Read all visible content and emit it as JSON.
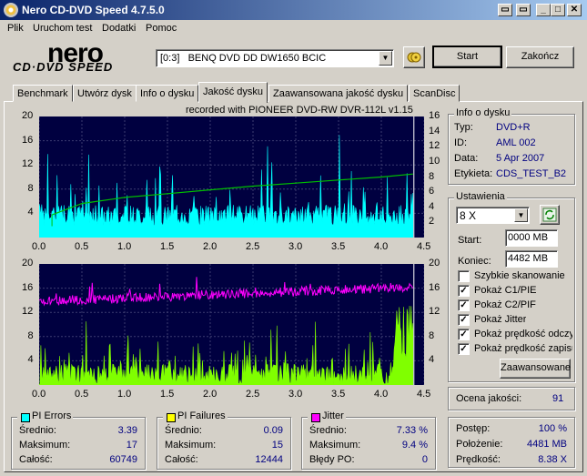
{
  "window": {
    "title": "Nero CD-DVD Speed 4.7.5.0"
  },
  "menu": [
    "Plik",
    "Uruchom test",
    "Dodatki",
    "Pomoc"
  ],
  "logo": {
    "brand": "nero",
    "product": "CD·DVD SPEED"
  },
  "drive": {
    "selected": "[0:3]   BENQ DVD DD DW1650 BCIC"
  },
  "buttons": {
    "start": "Start",
    "exit": "Zakończ",
    "advanced": "Zaawansowane"
  },
  "tabs": [
    "Benchmark",
    "Utwórz dysk",
    "Info o dysku",
    "Jakość dysku",
    "Zaawansowana jakość dysku",
    "ScanDisc"
  ],
  "active_tab": "Jakość dysku",
  "chart_header": "recorded with PIONEER DVD-RW  DVR-112L v1.15",
  "disc_info": {
    "title": "Info o dysku",
    "rows": [
      {
        "label": "Typ:",
        "value": "DVD+R"
      },
      {
        "label": "ID:",
        "value": "AML 002"
      },
      {
        "label": "Data:",
        "value": "5 Apr 2007"
      },
      {
        "label": "Etykieta:",
        "value": "CDS_TEST_B2"
      }
    ]
  },
  "settings": {
    "title": "Ustawienia",
    "speed": "8 X",
    "start_label": "Start:",
    "start_value": "0000 MB",
    "end_label": "Koniec:",
    "end_value": "4482 MB",
    "checkboxes": [
      {
        "label": "Szybkie skanowanie",
        "checked": false
      },
      {
        "label": "Pokaż C1/PIE",
        "checked": true
      },
      {
        "label": "Pokaż C2/PIF",
        "checked": true
      },
      {
        "label": "Pokaż Jitter",
        "checked": true
      },
      {
        "label": "Pokaż prędkość odczytu",
        "checked": true
      },
      {
        "label": "Pokaż prędkość zapisu",
        "checked": true
      }
    ]
  },
  "quality": {
    "label": "Ocena jakości:",
    "value": "91"
  },
  "progress": {
    "rows": [
      {
        "label": "Postęp:",
        "value": "100 %"
      },
      {
        "label": "Położenie:",
        "value": "4481 MB"
      },
      {
        "label": "Prędkość:",
        "value": "8.38 X"
      }
    ]
  },
  "stats": {
    "pi_errors": {
      "title": "PI Errors",
      "color": "#00ffff",
      "rows": [
        {
          "label": "Średnio:",
          "value": "3.39"
        },
        {
          "label": "Maksimum:",
          "value": "17"
        },
        {
          "label": "Całość:",
          "value": "60749"
        }
      ]
    },
    "pi_failures": {
      "title": "PI Failures",
      "color": "#ffff00",
      "rows": [
        {
          "label": "Średnio:",
          "value": "0.09"
        },
        {
          "label": "Maksimum:",
          "value": "15"
        },
        {
          "label": "Całość:",
          "value": "12444"
        }
      ]
    },
    "jitter": {
      "title": "Jitter",
      "color": "#ff00ff",
      "rows": [
        {
          "label": "Średnio:",
          "value": "7.33 %"
        },
        {
          "label": "Maksimum:",
          "value": "9.4 %"
        },
        {
          "label": "Błędy PO:",
          "value": "0"
        }
      ]
    }
  },
  "chart_data": [
    {
      "type": "area",
      "series": [
        {
          "name": "PI Errors",
          "color": "#00ffff",
          "average": 3.39,
          "max": 17
        },
        {
          "name": "Read speed",
          "color": "#00c000",
          "points": [
            [
              0.15,
              3.0
            ],
            [
              0.5,
              4.5
            ],
            [
              1.0,
              5.3
            ],
            [
              1.5,
              5.8
            ],
            [
              2.0,
              6.3
            ],
            [
              2.5,
              6.8
            ],
            [
              3.0,
              7.2
            ],
            [
              3.5,
              7.6
            ],
            [
              4.0,
              8.0
            ],
            [
              4.37,
              8.4
            ]
          ]
        }
      ],
      "x_ticks": [
        "0.0",
        "0.5",
        "1.0",
        "1.5",
        "2.0",
        "2.5",
        "3.0",
        "3.5",
        "4.0",
        "4.5"
      ],
      "y_left_ticks": [
        "20",
        "16",
        "12",
        "8",
        "4"
      ],
      "y_right_ticks": [
        "16",
        "14",
        "12",
        "10",
        "8",
        "6",
        "4",
        "2"
      ],
      "xlim": [
        0,
        4.5
      ],
      "ylim": [
        0,
        20
      ],
      "y2lim": [
        0,
        16
      ],
      "grid": true
    },
    {
      "type": "area",
      "series": [
        {
          "name": "PI Failures",
          "color": "#80ff00",
          "average": 0.09,
          "max": 15
        },
        {
          "name": "Jitter",
          "color": "#ff00ff",
          "average": 7.33,
          "max": 9.4
        }
      ],
      "x_ticks": [
        "0.0",
        "0.5",
        "1.0",
        "1.5",
        "2.0",
        "2.5",
        "3.0",
        "3.5",
        "4.0",
        "4.5"
      ],
      "y_left_ticks": [
        "20",
        "16",
        "12",
        "8",
        "4"
      ],
      "y_right_ticks": [
        "20",
        "16",
        "12",
        "8",
        "4"
      ],
      "xlim": [
        0,
        4.5
      ],
      "ylim": [
        0,
        20
      ],
      "y2lim": [
        0,
        20
      ],
      "grid": true
    }
  ]
}
